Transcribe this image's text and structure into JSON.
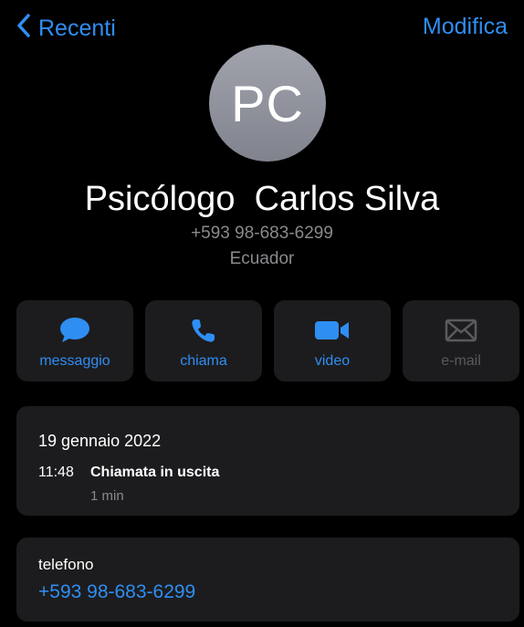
{
  "nav": {
    "back_label": "Recenti",
    "edit_label": "Modifica"
  },
  "contact": {
    "initials": "PC",
    "name": "Psicólogo  Carlos Silva",
    "phone": "+593 98-683-6299",
    "country": "Ecuador"
  },
  "actions": [
    {
      "label": "messaggio",
      "icon": "message-icon",
      "enabled": true
    },
    {
      "label": "chiama",
      "icon": "phone-icon",
      "enabled": true
    },
    {
      "label": "video",
      "icon": "video-icon",
      "enabled": true
    },
    {
      "label": "e-mail",
      "icon": "mail-icon",
      "enabled": false
    }
  ],
  "history": {
    "date": "19 gennaio 2022",
    "time": "11:48",
    "type": "Chiamata in uscita",
    "duration": "1 min"
  },
  "phone_field": {
    "label": "telefono",
    "value": "+593 98-683-6299"
  },
  "colors": {
    "accent": "#2f8ef2",
    "background": "#000000",
    "card": "#1c1c1e",
    "secondary_text": "#8a8a8e",
    "disabled": "#5a5a5e"
  }
}
